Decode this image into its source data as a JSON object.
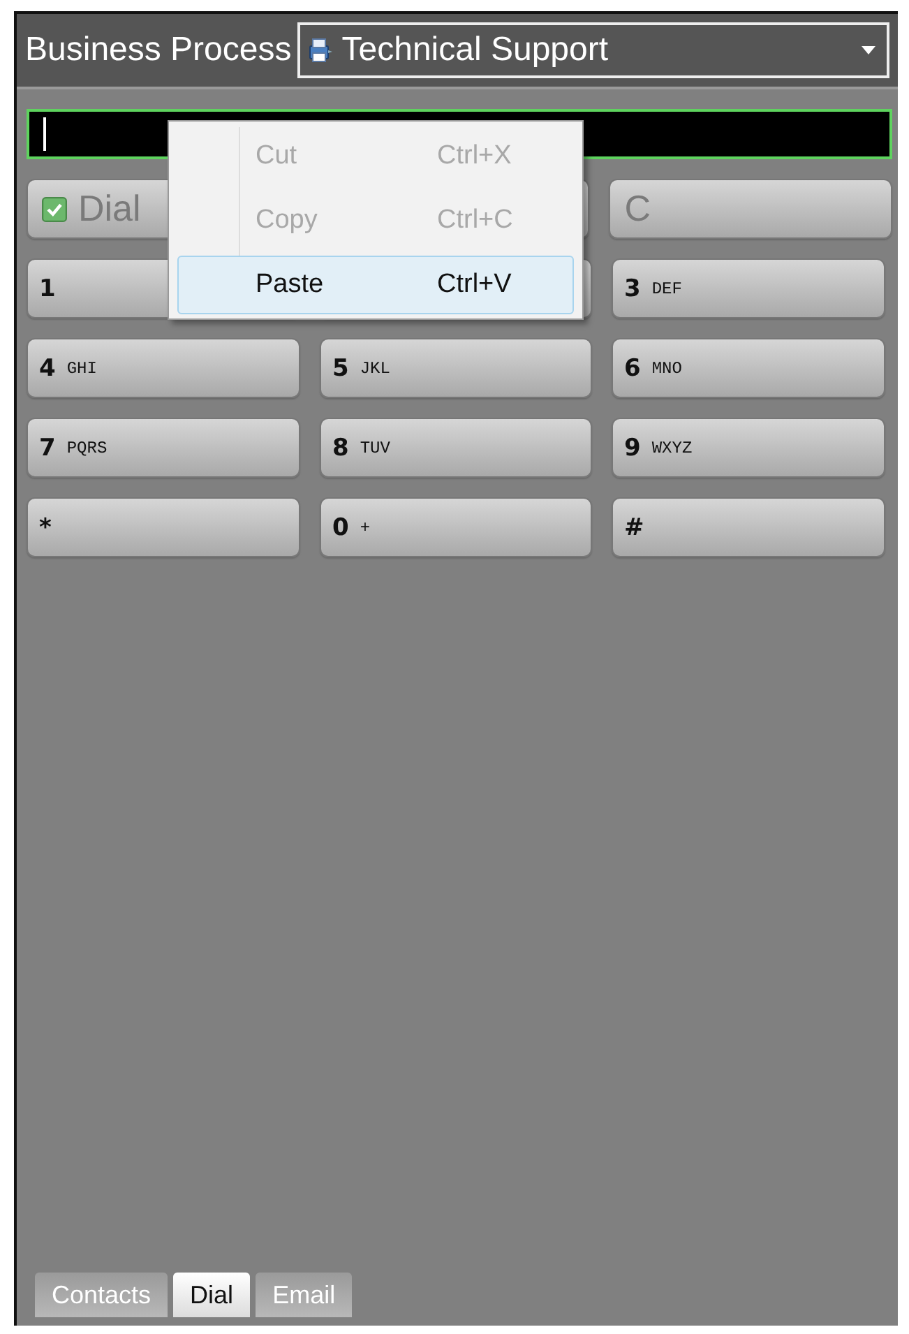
{
  "header": {
    "label": "Business Process",
    "dropdown": {
      "value": "Technical Support"
    }
  },
  "number_field": {
    "focused": true
  },
  "action_buttons": [
    {
      "label": "Dial",
      "kind": "dial",
      "disabled": true
    },
    {
      "label": "C",
      "kind": "clear",
      "disabled": true
    }
  ],
  "keypad": [
    {
      "kind": "key",
      "digit": "1"
    },
    {
      "kind": "key"
    },
    {
      "kind": "key",
      "digit": "3",
      "letters": "DEF"
    },
    {
      "kind": "key",
      "digit": "4",
      "letters": "GHI"
    },
    {
      "kind": "key",
      "digit": "5",
      "letters": "JKL"
    },
    {
      "kind": "key",
      "digit": "6",
      "letters": "MNO"
    },
    {
      "kind": "key",
      "digit": "7",
      "letters": "PQRS"
    },
    {
      "kind": "key",
      "digit": "8",
      "letters": "TUV"
    },
    {
      "kind": "key",
      "digit": "9",
      "letters": "WXYZ"
    },
    {
      "kind": "key",
      "digit": "*"
    },
    {
      "kind": "key",
      "digit": "0",
      "letters": "+"
    },
    {
      "kind": "key",
      "digit": "#"
    }
  ],
  "context_menu": [
    {
      "label": "Cut",
      "shortcut": "Ctrl+X",
      "disabled": true,
      "selected": false
    },
    {
      "label": "Copy",
      "shortcut": "Ctrl+C",
      "disabled": true,
      "selected": false
    },
    {
      "label": "Paste",
      "shortcut": "Ctrl+V",
      "disabled": false,
      "selected": true
    }
  ],
  "tabs": [
    {
      "label": "Contacts",
      "selected": false
    },
    {
      "label": "Dial",
      "selected": true
    },
    {
      "label": "Email",
      "selected": false
    }
  ]
}
